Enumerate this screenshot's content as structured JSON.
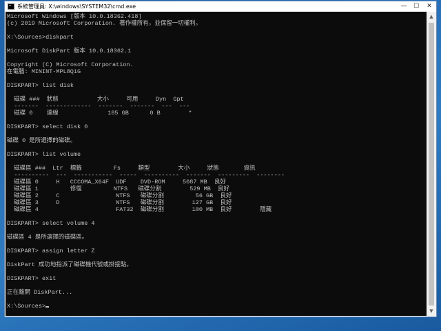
{
  "window": {
    "title": "系統管理員: X:\\windows\\SYSTEM32\\cmd.exe",
    "icon": "console-icon",
    "minimize_glyph": "—",
    "maximize_glyph": "☐",
    "close_glyph": "✕"
  },
  "console": {
    "lines": [
      "Microsoft Windows [版本 10.0.18362.418]",
      "(c) 2019 Microsoft Corporation. 著作權所有，並保留一切權利。",
      "",
      "X:\\Sources>diskpart",
      "",
      "Microsoft DiskPart 版本 10.0.18362.1",
      "",
      "Copyright (C) Microsoft Corporation.",
      "在電腦: MININT-MPL8Q1G",
      "",
      "DISKPART> list disk",
      "",
      "  磁碟 ###  狀態           大小     可用     Dyn  Gpt",
      "  -------  -------------  -------  -------  ---  ---",
      "  磁碟 0    連線              185 GB      0 B        *",
      "",
      "DISKPART> select disk 0",
      "",
      "磁碟 0 是所選擇的磁碟。",
      "",
      "DISKPART> list volume",
      "",
      "  磁碟區 ###  Ltr  標籤         Fs     類型        大小     狀態       資訊",
      "  ----------  ---  -----------  -----  ----------  -------  ---------  --------",
      "  磁碟區 0     H   CCCOMA_X64F  UDF    DVD-ROM     5087 MB  良好",
      "  磁碟區 1         修復         NTFS   磁碟分割        529 MB  良好",
      "  磁碟區 2     C                NTFS   磁碟分割         56 GB  良好",
      "  磁碟區 3     D                NTFS   磁碟分割        127 GB  良好",
      "  磁碟區 4                      FAT32  磁碟分割        100 MB  良好        隱藏",
      "",
      "DISKPART> select volume 4",
      "",
      "磁碟區 4 是所選擇的磁碟區。",
      "",
      "DISKPART> assign letter Z",
      "",
      "DiskPart 成功地指派了磁碟機代號或掛接點。",
      "",
      "DISKPART> exit",
      "",
      "正在離開 DiskPart...",
      "",
      "X:\\Sources>"
    ]
  }
}
